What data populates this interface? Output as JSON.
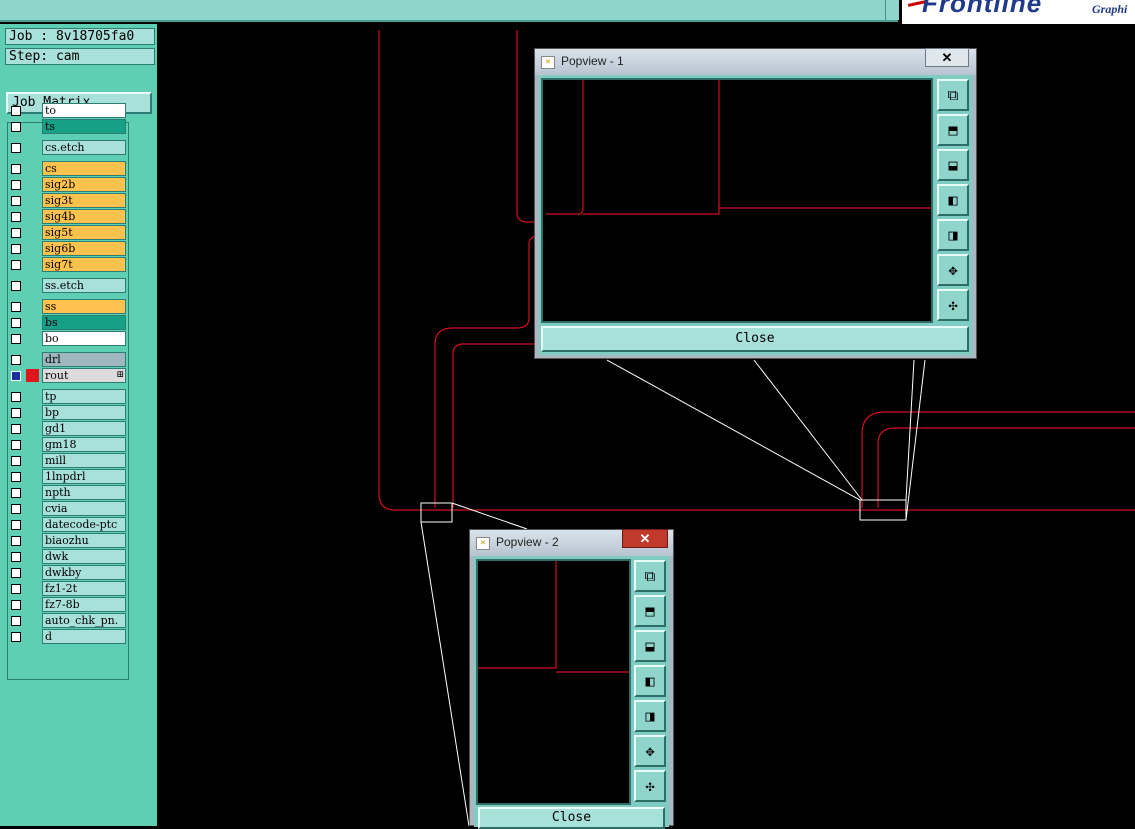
{
  "job_label": "Job : 8v18705fa0",
  "step_label": "Step: cam",
  "job_matrix_label": "Job Matrix ...",
  "brand": {
    "name": "Frontline",
    "sub": "Graphi"
  },
  "layers": [
    {
      "name": "to",
      "color": "#ffffff"
    },
    {
      "name": "ts",
      "color": "#16a085"
    },
    {
      "name": "cs.etch",
      "color": "#a8e0da"
    },
    {
      "name": "cs",
      "color": "#ffc34d"
    },
    {
      "name": "sig2b",
      "color": "#ffc34d"
    },
    {
      "name": "sig3t",
      "color": "#ffc34d"
    },
    {
      "name": "sig4b",
      "color": "#ffc34d"
    },
    {
      "name": "sig5t",
      "color": "#ffc34d"
    },
    {
      "name": "sig6b",
      "color": "#ffc34d"
    },
    {
      "name": "sig7t",
      "color": "#ffc34d"
    },
    {
      "name": "ss.etch",
      "color": "#a8e0da"
    },
    {
      "name": "ss",
      "color": "#ffc34d"
    },
    {
      "name": "bs",
      "color": "#16a085"
    },
    {
      "name": "bo",
      "color": "#ffffff"
    },
    {
      "name": "drl",
      "color": "#9fb8c0"
    },
    {
      "name": "rout",
      "color": "#dcdcdc",
      "active": true
    },
    {
      "name": "tp",
      "color": "#a8e0da"
    },
    {
      "name": "bp",
      "color": "#a8e0da"
    },
    {
      "name": "gd1",
      "color": "#a8e0da"
    },
    {
      "name": "gm18",
      "color": "#a8e0da"
    },
    {
      "name": "mill",
      "color": "#a8e0da"
    },
    {
      "name": "1lnpdrl",
      "color": "#a8e0da"
    },
    {
      "name": "npth",
      "color": "#a8e0da"
    },
    {
      "name": "cvia",
      "color": "#a8e0da"
    },
    {
      "name": "datecode-ptc",
      "color": "#a8e0da"
    },
    {
      "name": "biaozhu",
      "color": "#a8e0da"
    },
    {
      "name": "dwk",
      "color": "#a8e0da"
    },
    {
      "name": "dwkby",
      "color": "#a8e0da"
    },
    {
      "name": "fz1-2t",
      "color": "#a8e0da"
    },
    {
      "name": "fz7-8b",
      "color": "#a8e0da"
    },
    {
      "name": "auto_chk_pn.",
      "color": "#a8e0da"
    },
    {
      "name": "d",
      "color": "#a8e0da"
    }
  ],
  "popviews": [
    {
      "title": "Popview - 1",
      "close_label": "Close",
      "close_x": "✕"
    },
    {
      "title": "Popview - 2",
      "close_label": "Close",
      "close_x": "✕"
    }
  ],
  "tool_icons": [
    "window-icon",
    "pan-up-icon",
    "pan-down-icon",
    "pan-left-icon",
    "pan-right-icon",
    "zoom-in-icon",
    "zoom-out-icon"
  ],
  "colors": {
    "panel": "#5fcfb3",
    "button": "#a8e0da",
    "trace": "#d01020"
  }
}
